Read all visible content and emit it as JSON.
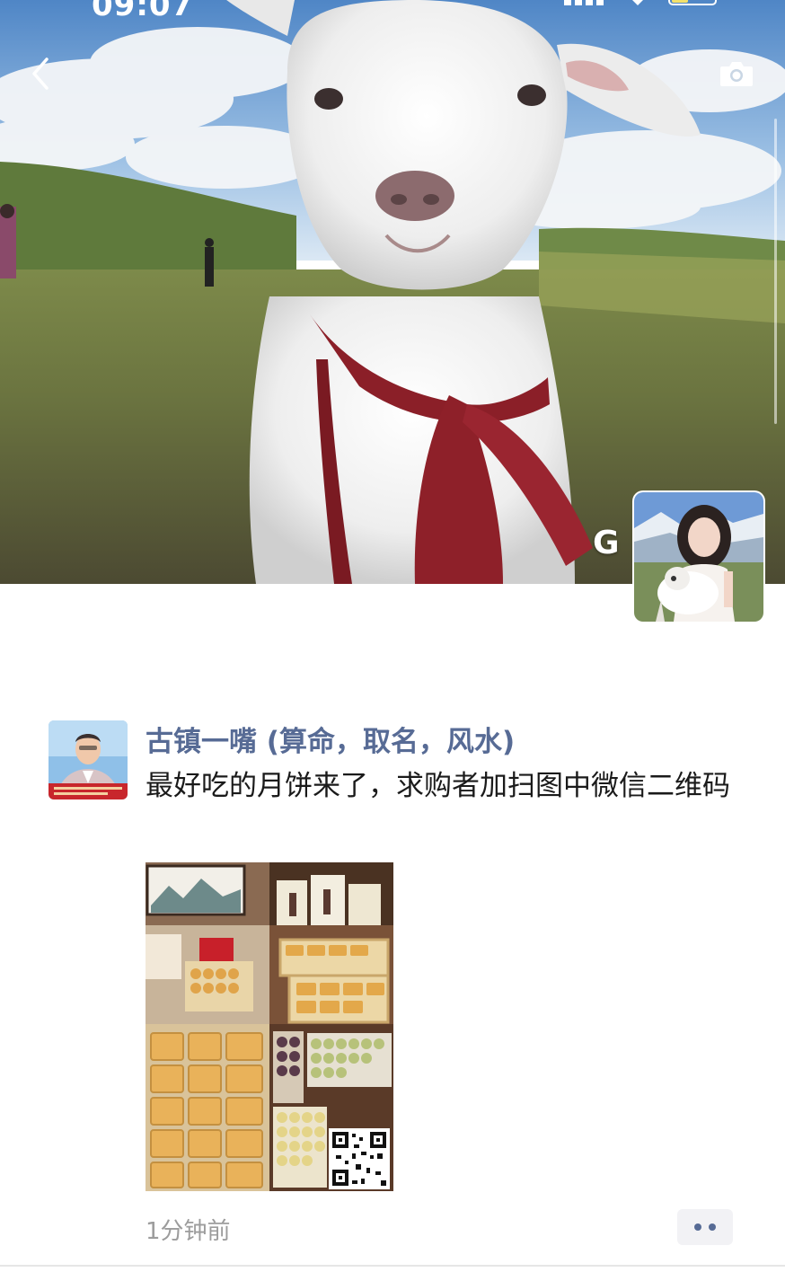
{
  "status_bar": {
    "time": "09:07"
  },
  "cover": {
    "display_name": "G",
    "back_icon": "chevron-left-icon",
    "camera_icon": "camera-icon"
  },
  "post": {
    "author": "古镇一嘴 (算命，取名，风水)",
    "text": "最好吃的月饼来了，求购者加扫图中微信二维码",
    "time_ago": "1分钟前",
    "more_icon": "more-dots-icon"
  },
  "colors": {
    "author_link": "#576b95",
    "timestamp": "#9c9c9c",
    "more_button_bg": "#f2f2f5"
  }
}
